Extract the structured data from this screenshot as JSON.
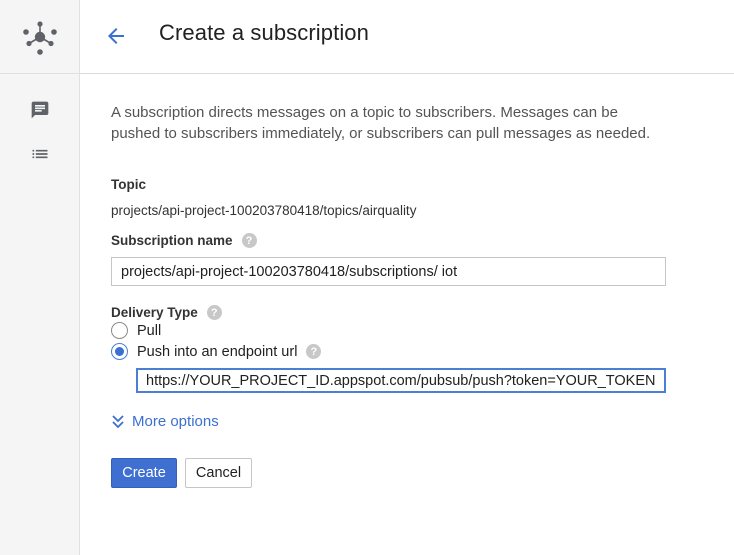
{
  "header": {
    "title": "Create a subscription"
  },
  "form": {
    "description": "A subscription directs messages on a topic to subscribers. Messages can be pushed to subscribers immediately, or subscribers can pull messages as needed.",
    "topic_label": "Topic",
    "topic_value": "projects/api-project-100203780418/topics/airquality",
    "subscription_name_label": "Subscription name",
    "subscription_name_value": "projects/api-project-100203780418/subscriptions/ iot",
    "delivery_type_label": "Delivery Type",
    "delivery_options": [
      {
        "label": "Pull",
        "selected": false
      },
      {
        "label": "Push into an endpoint url",
        "selected": true
      }
    ],
    "endpoint_url_value": "https://YOUR_PROJECT_ID.appspot.com/pubsub/push?token=YOUR_TOKEN",
    "more_options_label": "More options",
    "create_label": "Create",
    "cancel_label": "Cancel",
    "help_glyph": "?"
  },
  "icons": {
    "logo": "pubsub-logo-icon",
    "rail_first": "chat-bubble-icon",
    "rail_second": "list-icon",
    "back": "arrow-back-icon",
    "help": "help-icon",
    "more_options": "chevron-double-down-icon"
  },
  "colors": {
    "accent": "#3b6fd1",
    "rail_background": "#f5f5f5",
    "icon_gray": "#5f6368"
  }
}
